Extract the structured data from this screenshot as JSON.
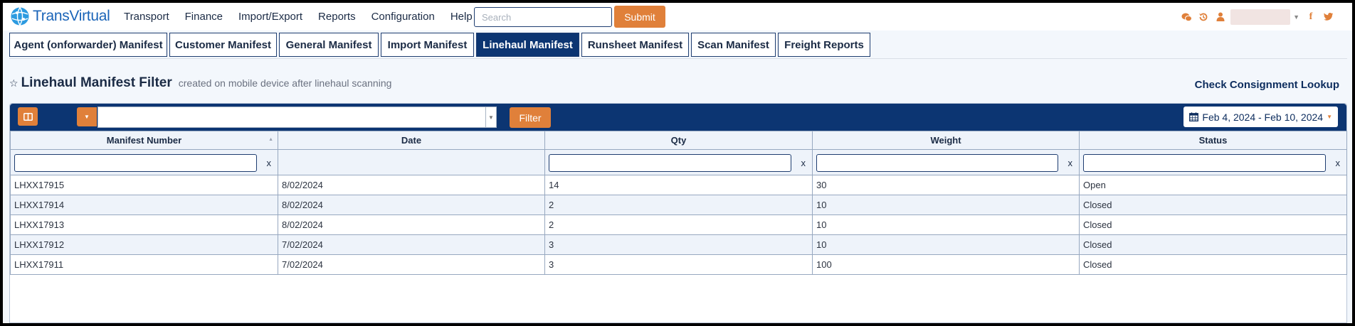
{
  "app": {
    "brand": "TransVirtual"
  },
  "nav": {
    "items": [
      "Transport",
      "Finance",
      "Import/Export",
      "Reports",
      "Configuration",
      "Help"
    ],
    "search_placeholder": "Search",
    "submit_label": "Submit"
  },
  "tabs": [
    {
      "label": "Agent (onforwarder) Manifest",
      "active": false
    },
    {
      "label": "Customer Manifest",
      "active": false
    },
    {
      "label": "General Manifest",
      "active": false
    },
    {
      "label": "Import Manifest",
      "active": false
    },
    {
      "label": "Linehaul Manifest",
      "active": true
    },
    {
      "label": "Runsheet Manifest",
      "active": false
    },
    {
      "label": "Scan Manifest",
      "active": false
    },
    {
      "label": "Freight Reports",
      "active": false
    }
  ],
  "page": {
    "title": "Linehaul Manifest Filter",
    "subtitle": "created on mobile device after linehaul scanning",
    "lookup_link": "Check Consignment Lookup"
  },
  "filterbar": {
    "filter_label": "Filter",
    "date_range": "Feb 4, 2024 - Feb 10, 2024"
  },
  "table": {
    "columns": [
      "Manifest Number",
      "Date",
      "Qty",
      "Weight",
      "Status"
    ],
    "clear_label": "x",
    "rows": [
      [
        "LHXX17915",
        "8/02/2024",
        "14",
        "30",
        "Open"
      ],
      [
        "LHXX17914",
        "8/02/2024",
        "2",
        "10",
        "Closed"
      ],
      [
        "LHXX17913",
        "8/02/2024",
        "2",
        "10",
        "Closed"
      ],
      [
        "LHXX17912",
        "7/02/2024",
        "3",
        "10",
        "Closed"
      ],
      [
        "LHXX17911",
        "7/02/2024",
        "3",
        "100",
        "Closed"
      ]
    ]
  },
  "colors": {
    "navy": "#0c3572",
    "accent": "#e0803a",
    "brand": "#1a64b8"
  }
}
